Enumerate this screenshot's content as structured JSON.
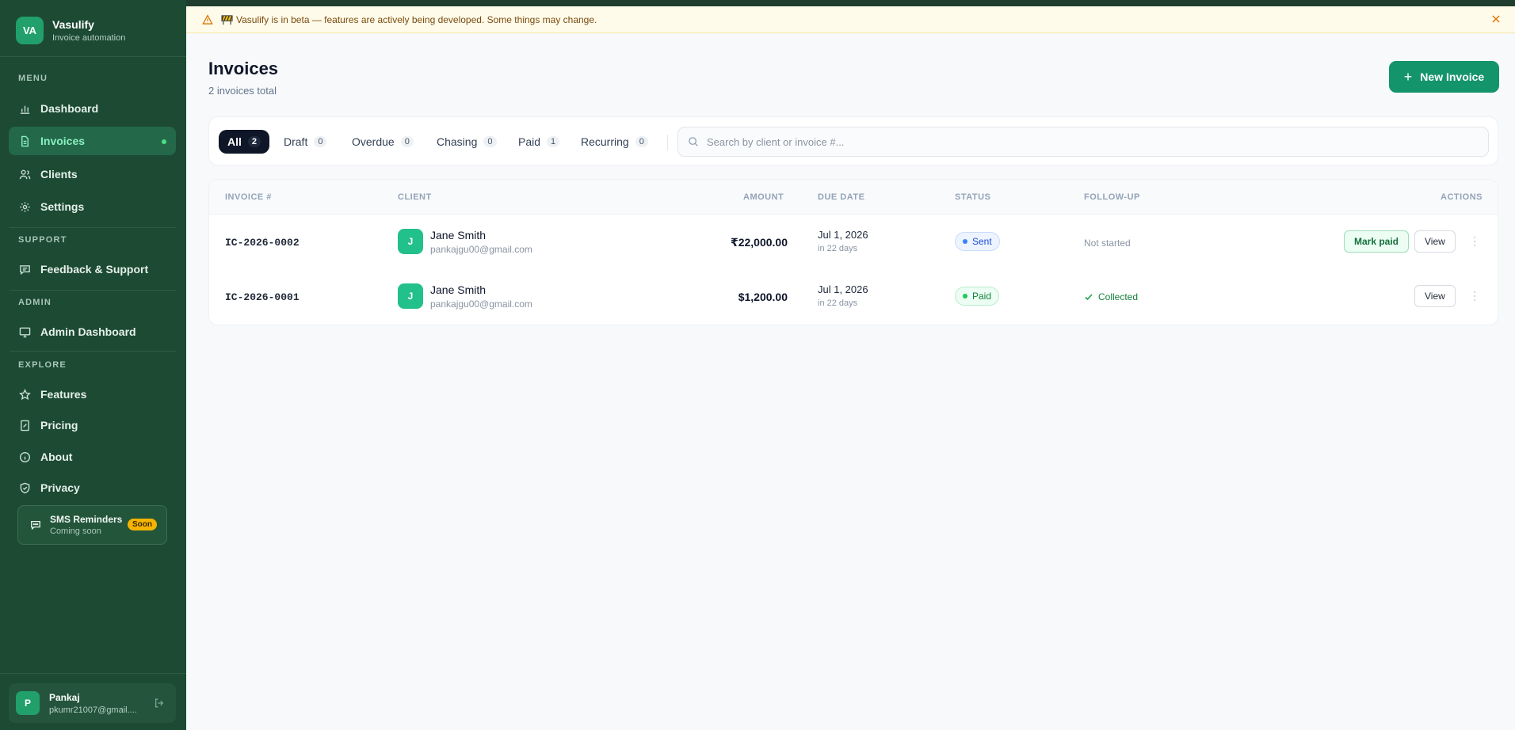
{
  "brand": {
    "logo_initials": "VA",
    "name": "Vasulify",
    "tagline": "Invoice automation"
  },
  "sidebar": {
    "sections": {
      "menu": "MENU",
      "support": "SUPPORT",
      "admin": "ADMIN",
      "explore": "EXPLORE"
    },
    "items": {
      "dashboard": "Dashboard",
      "invoices": "Invoices",
      "clients": "Clients",
      "settings": "Settings",
      "feedback": "Feedback & Support",
      "admin_dashboard": "Admin Dashboard",
      "features": "Features",
      "pricing": "Pricing",
      "about": "About",
      "privacy": "Privacy"
    },
    "sms_card": {
      "title": "SMS Reminders",
      "subtitle": "Coming soon",
      "badge": "Soon"
    },
    "user": {
      "initial": "P",
      "name": "Pankaj",
      "email": "pkumr21007@gmail...."
    }
  },
  "banner": {
    "text": "Vasulify is in beta — features are actively being developed. Some things may change."
  },
  "header": {
    "title": "Invoices",
    "subtitle": "2 invoices total",
    "new_button": "New Invoice"
  },
  "filters": {
    "tabs": [
      {
        "label": "All",
        "count": "2"
      },
      {
        "label": "Draft",
        "count": "0"
      },
      {
        "label": "Overdue",
        "count": "0"
      },
      {
        "label": "Chasing",
        "count": "0"
      },
      {
        "label": "Paid",
        "count": "1"
      },
      {
        "label": "Recurring",
        "count": "0"
      }
    ],
    "search_placeholder": "Search by client or invoice #..."
  },
  "table": {
    "columns": {
      "invoice": "INVOICE #",
      "client": "CLIENT",
      "amount": "AMOUNT",
      "due_date": "DUE DATE",
      "status": "STATUS",
      "follow_up": "FOLLOW-UP",
      "actions": "ACTIONS"
    },
    "rows": [
      {
        "invoice": "IC-2026-0002",
        "client_initial": "J",
        "client_name": "Jane Smith",
        "client_email": "pankajgu00@gmail.com",
        "amount": "₹22,000.00",
        "due_date": "Jul 1, 2026",
        "due_rel": "in 22 days",
        "status": "Sent",
        "follow_up": "Not started",
        "mark_paid": "Mark paid",
        "view": "View"
      },
      {
        "invoice": "IC-2026-0001",
        "client_initial": "J",
        "client_name": "Jane Smith",
        "client_email": "pankajgu00@gmail.com",
        "amount": "$1,200.00",
        "due_date": "Jul 1, 2026",
        "due_rel": "in 22 days",
        "status": "Paid",
        "follow_up": "Collected",
        "view": "View"
      }
    ]
  },
  "colors": {
    "sidebar_bg": "#1c4a33",
    "accent": "#14946a",
    "active_nav": "#24684a",
    "banner_bg": "#fffbea"
  }
}
